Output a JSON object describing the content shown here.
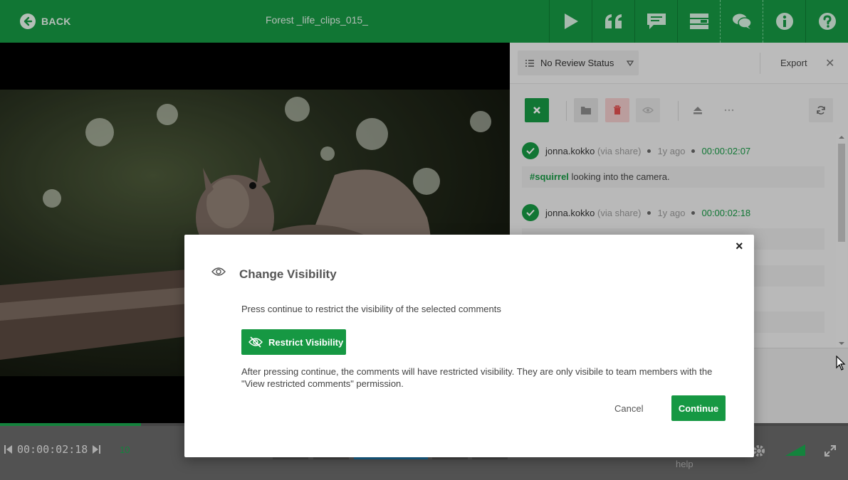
{
  "header": {
    "back_label": "BACK",
    "title": "Forest _life_clips_015_",
    "icons": [
      "play-icon",
      "quote-icon",
      "comment-icon",
      "layout-icon",
      "chat-icon",
      "info-icon",
      "help-icon"
    ]
  },
  "panel": {
    "review_status": "No Review Status",
    "export_label": "Export",
    "close_symbol": "✕",
    "comments": [
      {
        "author": "jonna.kokko",
        "via": "(via share)",
        "age": "1y ago",
        "timecode": "00:00:02:07",
        "tag": "#squirrel",
        "text": " looking into the camera."
      },
      {
        "author": "jonna.kokko",
        "via": "(via share)",
        "age": "1y ago",
        "timecode": "00:00:02:18"
      }
    ]
  },
  "player": {
    "timecode": "00:00:02:18",
    "frame_rate": "10",
    "help_label": "help",
    "progress": 0.166
  },
  "modal": {
    "close_symbol": "×",
    "title": "Change Visibility",
    "description": "Press continue to restrict the visibility of the selected comments",
    "restrict_label": "Restrict Visibility",
    "note": "After pressing continue, the comments will have restricted visibility. They are only visibile to team members with the \"View restricted comments\" permission.",
    "cancel_label": "Cancel",
    "continue_label": "Continue"
  },
  "colors": {
    "brand_green": "#169843",
    "overlay": "rgba(0,0,0,0.22)"
  }
}
